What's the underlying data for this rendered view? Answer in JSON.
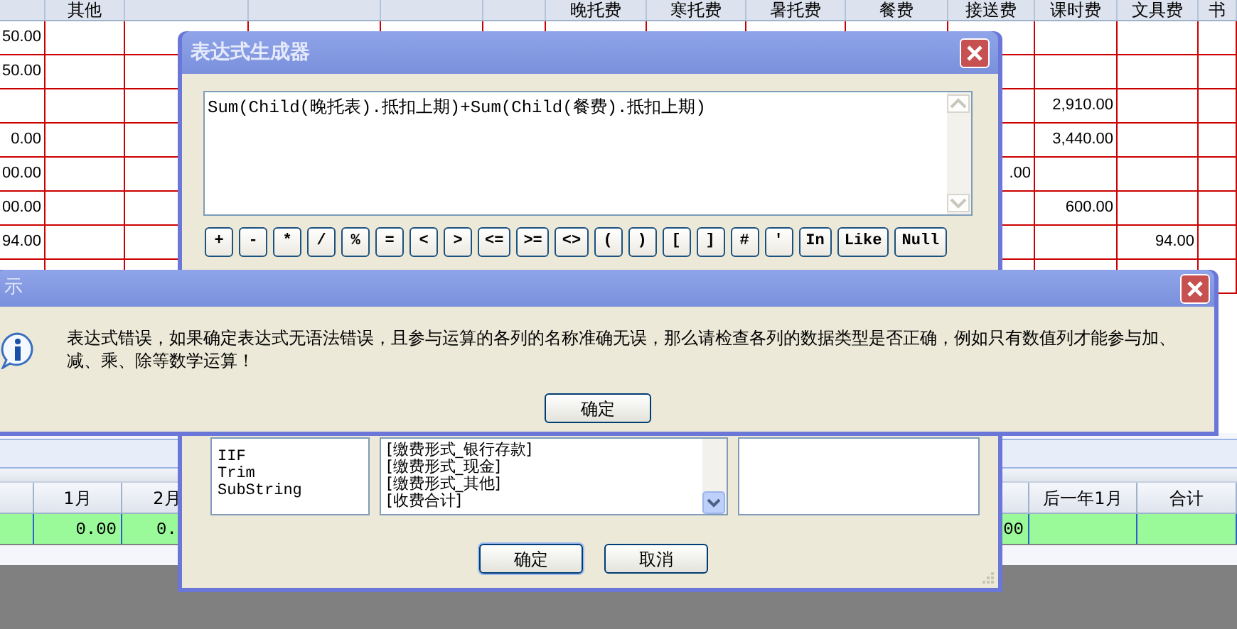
{
  "spreadsheet": {
    "headers": [
      "其他",
      "晚托费",
      "寒托费",
      "暑托费",
      "餐费",
      "接送费",
      "课时费",
      "文具费",
      "书"
    ],
    "rows": [
      [
        "50.00",
        null,
        null,
        null,
        null,
        null,
        null,
        null,
        null,
        null,
        null,
        null,
        null,
        null
      ],
      [
        "50.00",
        null,
        null,
        null,
        null,
        null,
        null,
        null,
        null,
        null,
        null,
        null,
        null,
        null
      ],
      [
        null,
        null,
        null,
        null,
        null,
        null,
        null,
        null,
        null,
        null,
        null,
        "2,910.00",
        null,
        null
      ],
      [
        "0.00",
        null,
        null,
        null,
        null,
        null,
        null,
        null,
        null,
        null,
        null,
        "3,440.00",
        null,
        null
      ],
      [
        "00.00",
        null,
        null,
        null,
        null,
        null,
        null,
        null,
        null,
        null,
        ".00",
        null,
        null,
        null
      ],
      [
        "00.00",
        null,
        null,
        null,
        null,
        null,
        null,
        null,
        null,
        null,
        null,
        "600.00",
        null,
        null
      ],
      [
        "94.00",
        null,
        null,
        null,
        null,
        null,
        null,
        null,
        null,
        null,
        null,
        null,
        "94.00",
        null
      ],
      [
        null,
        null,
        null,
        null,
        null,
        null,
        null,
        null,
        null,
        null,
        null,
        null,
        null,
        null
      ]
    ]
  },
  "summary": {
    "columns": [
      {
        "header": "1月",
        "value": "0.00"
      },
      {
        "header": "2月",
        "value": "0."
      },
      {
        "value": "00"
      },
      {
        "header": "后一年1月"
      },
      {
        "header": "合计"
      }
    ]
  },
  "expression_dialog": {
    "title": "表达式生成器",
    "expression": "Sum(Child(晚托表).抵扣上期)+Sum(Child(餐费).抵扣上期)",
    "operators": [
      "+",
      "-",
      "*",
      "/",
      "%",
      "=",
      "<",
      ">",
      "<=",
      ">=",
      "<>",
      "(",
      ")",
      "[",
      "]",
      "#",
      "'",
      "In",
      "Like",
      "Null"
    ],
    "functions": [
      "IIF",
      "Trim",
      "SubString"
    ],
    "fields": [
      "[缴费形式_银行存款]",
      "[缴费形式_现金]",
      "[缴费形式_其他]",
      "[收费合计]"
    ],
    "buttons": [
      "确定",
      "取消"
    ]
  },
  "message_box": {
    "title": "示",
    "message": "表达式错误，如果确定表达式无语法错误，且参与运算的各列的名称准确无误，那么请检查各列的数据类型是否正确，例如只有数值列才能参与加、减、乘、除等数学运算！",
    "button": "确定"
  }
}
